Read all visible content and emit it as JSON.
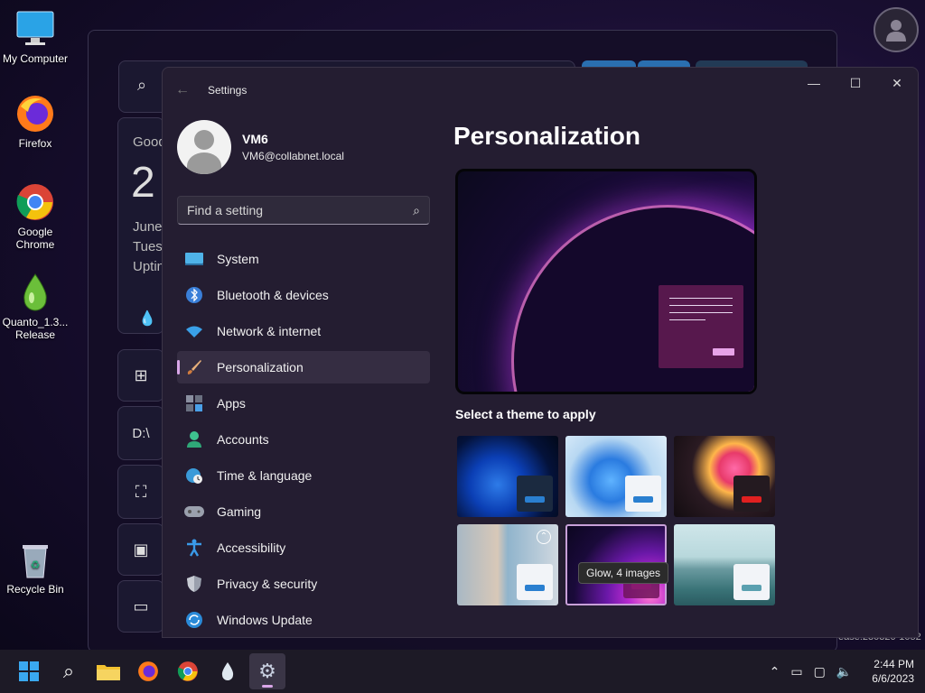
{
  "desktop": {
    "icons": [
      {
        "label": "My Computer"
      },
      {
        "label": "Firefox"
      },
      {
        "label": "Google Chrome"
      },
      {
        "label": "Quanto_1.3... Release"
      },
      {
        "label": "Recycle Bin"
      }
    ],
    "background_widget": {
      "greeting": "Good",
      "day_number": "2",
      "lines": [
        "June",
        "Tues",
        "Uptin"
      ],
      "drive_label": "D:\\",
      "build_text": "ease:230320-1052"
    }
  },
  "settings": {
    "window_title": "Settings",
    "back_glyph": "←",
    "controls": {
      "minimize": "—",
      "maximize": "☐",
      "close": "✕"
    },
    "profile": {
      "name": "VM6",
      "email": "VM6@collabnet.local"
    },
    "search": {
      "placeholder": "Find a setting"
    },
    "nav_items": [
      {
        "label": "System",
        "icon": "system-icon"
      },
      {
        "label": "Bluetooth & devices",
        "icon": "bluetooth-icon"
      },
      {
        "label": "Network & internet",
        "icon": "wifi-icon"
      },
      {
        "label": "Personalization",
        "icon": "brush-icon",
        "active": true
      },
      {
        "label": "Apps",
        "icon": "apps-icon"
      },
      {
        "label": "Accounts",
        "icon": "accounts-icon"
      },
      {
        "label": "Time & language",
        "icon": "globe-clock-icon"
      },
      {
        "label": "Gaming",
        "icon": "gamepad-icon"
      },
      {
        "label": "Accessibility",
        "icon": "accessibility-icon"
      },
      {
        "label": "Privacy & security",
        "icon": "shield-icon"
      },
      {
        "label": "Windows Update",
        "icon": "update-icon"
      }
    ],
    "page_title": "Personalization",
    "themes_heading": "Select a theme to apply",
    "theme_tooltip": "Glow, 4 images",
    "themes": [
      {
        "name": "windows-light-blue-bloom"
      },
      {
        "name": "windows-light-bloom"
      },
      {
        "name": "captured-motion"
      },
      {
        "name": "flow"
      },
      {
        "name": "glow",
        "selected": true
      },
      {
        "name": "sunrise"
      }
    ]
  },
  "taskbar": {
    "apps": [
      "start-icon",
      "search-icon",
      "file-explorer-icon",
      "firefox-icon",
      "chrome-icon",
      "quanto-icon",
      "settings-icon"
    ],
    "time": "2:44 PM",
    "date": "6/6/2023"
  },
  "colors": {
    "accent": "#d9a6e8",
    "window_bg": "#241d31",
    "taskbar_bg": "#1d1a26"
  }
}
